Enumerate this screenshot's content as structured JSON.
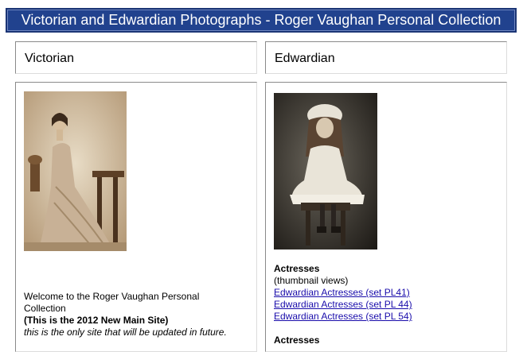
{
  "banner": {
    "title": "Victorian and Edwardian Photographs - Roger Vaughan Personal Collection"
  },
  "victorian": {
    "heading": "Victorian",
    "photo_icon": "victorian-woman-photo",
    "welcome_line1": "Welcome to the Roger Vaughan Personal",
    "welcome_line2": "Collection",
    "new_site": "(This is the 2012 New Main Site)",
    "only_site": "this is the only site that will be updated in future."
  },
  "edwardian": {
    "heading": "Edwardian",
    "photo_icon": "edwardian-girl-photo",
    "actresses_title": "Actresses",
    "thumb_views": "(thumbnail views)",
    "links": [
      "Edwardian Actresses (set PL41)",
      "Edwardian Actresses (set PL 44)",
      "Edwardian Actresses (set PL 54)"
    ],
    "actresses_title2": "Actresses"
  },
  "colors": {
    "banner_bg": "#21428e",
    "link": "#1a0dab"
  }
}
